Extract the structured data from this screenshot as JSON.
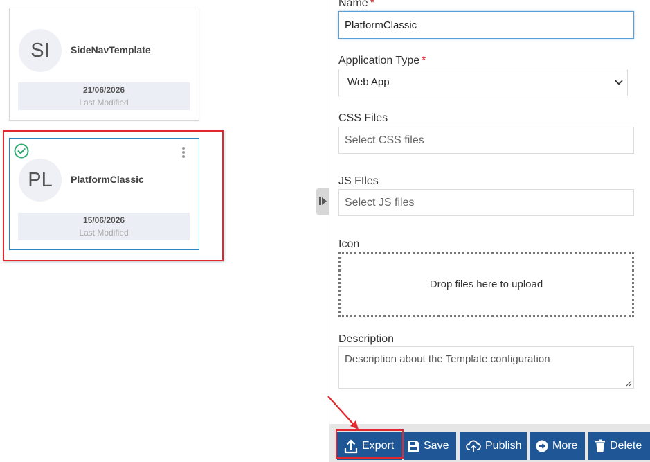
{
  "templates": [
    {
      "initials": "SI",
      "name": "SideNavTemplate",
      "date": "21/06/2026",
      "meta_label": "Last Modified",
      "selected": false
    },
    {
      "initials": "PL",
      "name": "PlatformClassic",
      "date": "15/06/2026",
      "meta_label": "Last Modified",
      "selected": true
    }
  ],
  "form": {
    "name_label": "Name",
    "name_value": "PlatformClassic",
    "required_mark": "*",
    "app_type_label": "Application Type",
    "app_type_value": "Web App",
    "css_label": "CSS Files",
    "css_placeholder": "Select CSS files",
    "js_label": "JS FIles",
    "js_placeholder": "Select JS files",
    "icon_label": "Icon",
    "dropzone_text": "Drop files here to upload",
    "description_label": "Description",
    "description_placeholder": "Description about the Template configuration"
  },
  "toolbar": {
    "export_label": "Export",
    "save_label": "Save",
    "publish_label": "Publish",
    "more_label": "More",
    "delete_label": "Delete"
  },
  "colors": {
    "primary_button": "#1f5796",
    "highlight": "#e0282e",
    "selected_border": "#2b86c5",
    "check": "#2eaa6e"
  }
}
